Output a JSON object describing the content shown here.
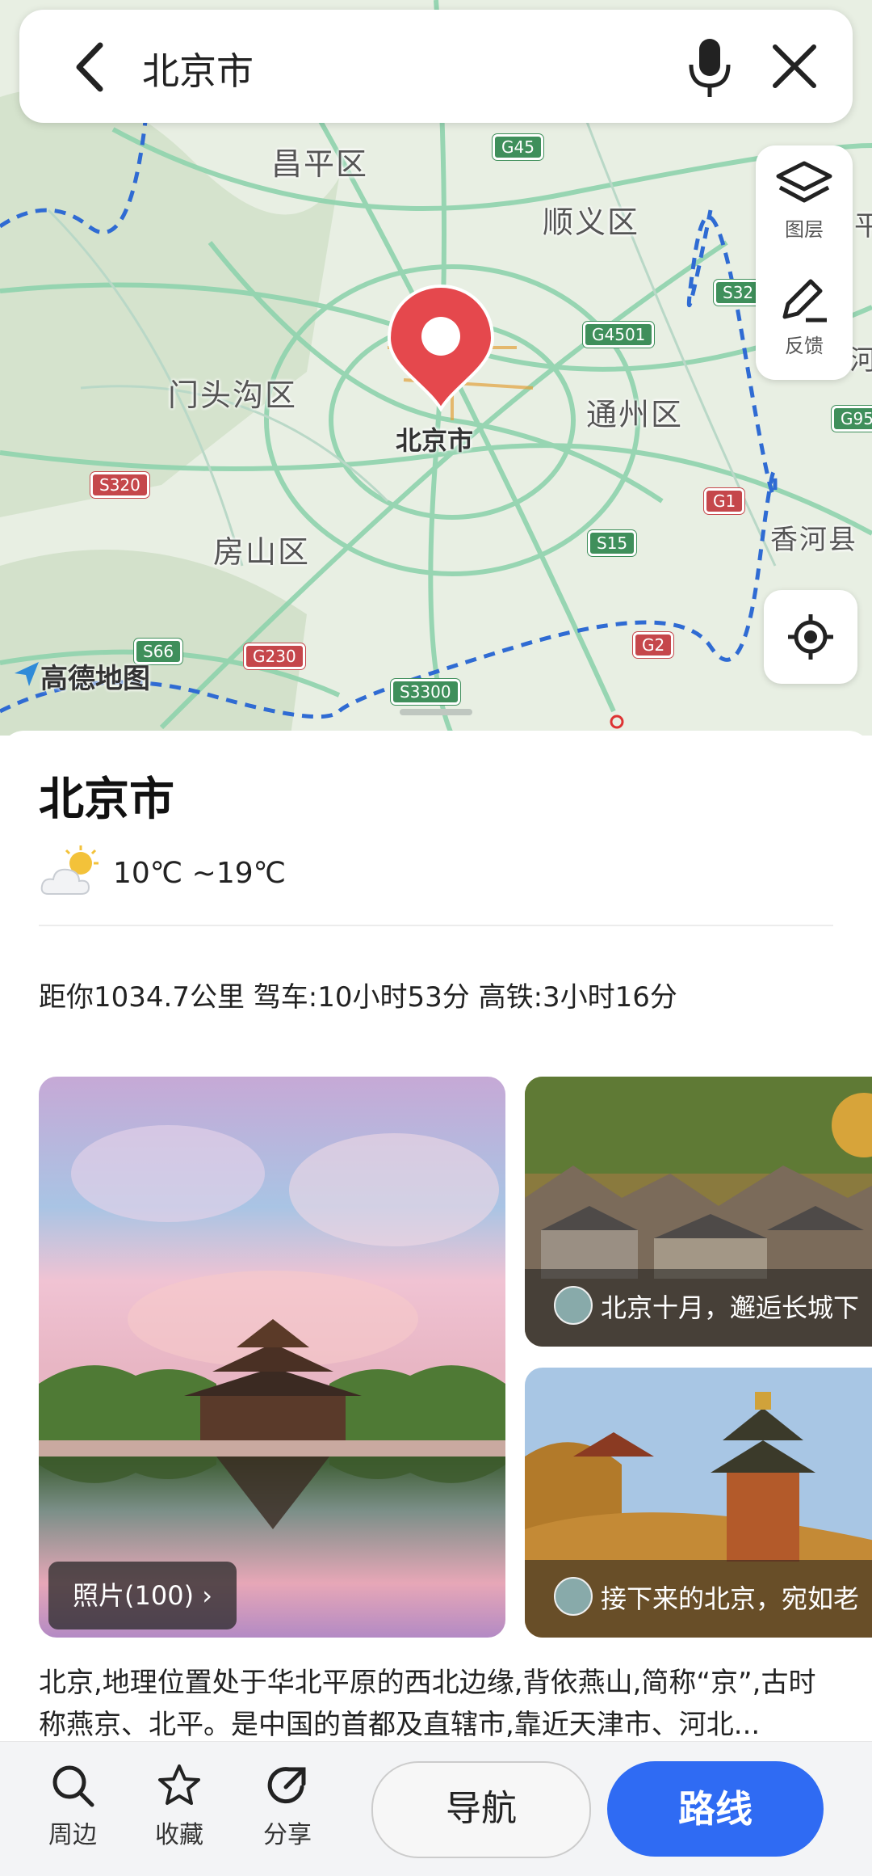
{
  "search": {
    "query": "北京市"
  },
  "map": {
    "tools": [
      {
        "label": "图层",
        "icon": "layers-icon"
      },
      {
        "label": "反馈",
        "icon": "edit-feedback-icon"
      }
    ],
    "pin_label": "北京市",
    "districts": [
      "昌平区",
      "顺义区",
      "门头沟区",
      "通州区",
      "房山区",
      "香河县"
    ],
    "road_shields": [
      "G45",
      "S32",
      "G4501",
      "G95",
      "S320",
      "G1",
      "S15",
      "S66",
      "G230",
      "G2",
      "S3300"
    ],
    "brand": "高德地图",
    "edge_labels": [
      "平",
      "河"
    ]
  },
  "place": {
    "title": "北京市",
    "weather": "10℃ ~19℃",
    "distance": "距你1034.7公里 驾车:10小时53分 高铁:3小时16分",
    "photo_count": "照片(100)",
    "side_photos": [
      {
        "caption": "北京十月，邂逅长城下"
      },
      {
        "caption": "接下来的北京，宛如老"
      }
    ],
    "description": "北京,地理位置处于华北平原的西北边缘,背依燕山,简称“京”,古时称燕京、北平。是中国的首都及直辖市,靠近天津市、河北..."
  },
  "bottom_bar": {
    "items": [
      {
        "label": "周边",
        "icon": "search-icon"
      },
      {
        "label": "收藏",
        "icon": "star-icon"
      },
      {
        "label": "分享",
        "icon": "share-icon"
      }
    ],
    "nav_label": "导航",
    "route_label": "路线"
  },
  "colors": {
    "route_button": "#2f6bf3",
    "pin": "#e5484d"
  }
}
